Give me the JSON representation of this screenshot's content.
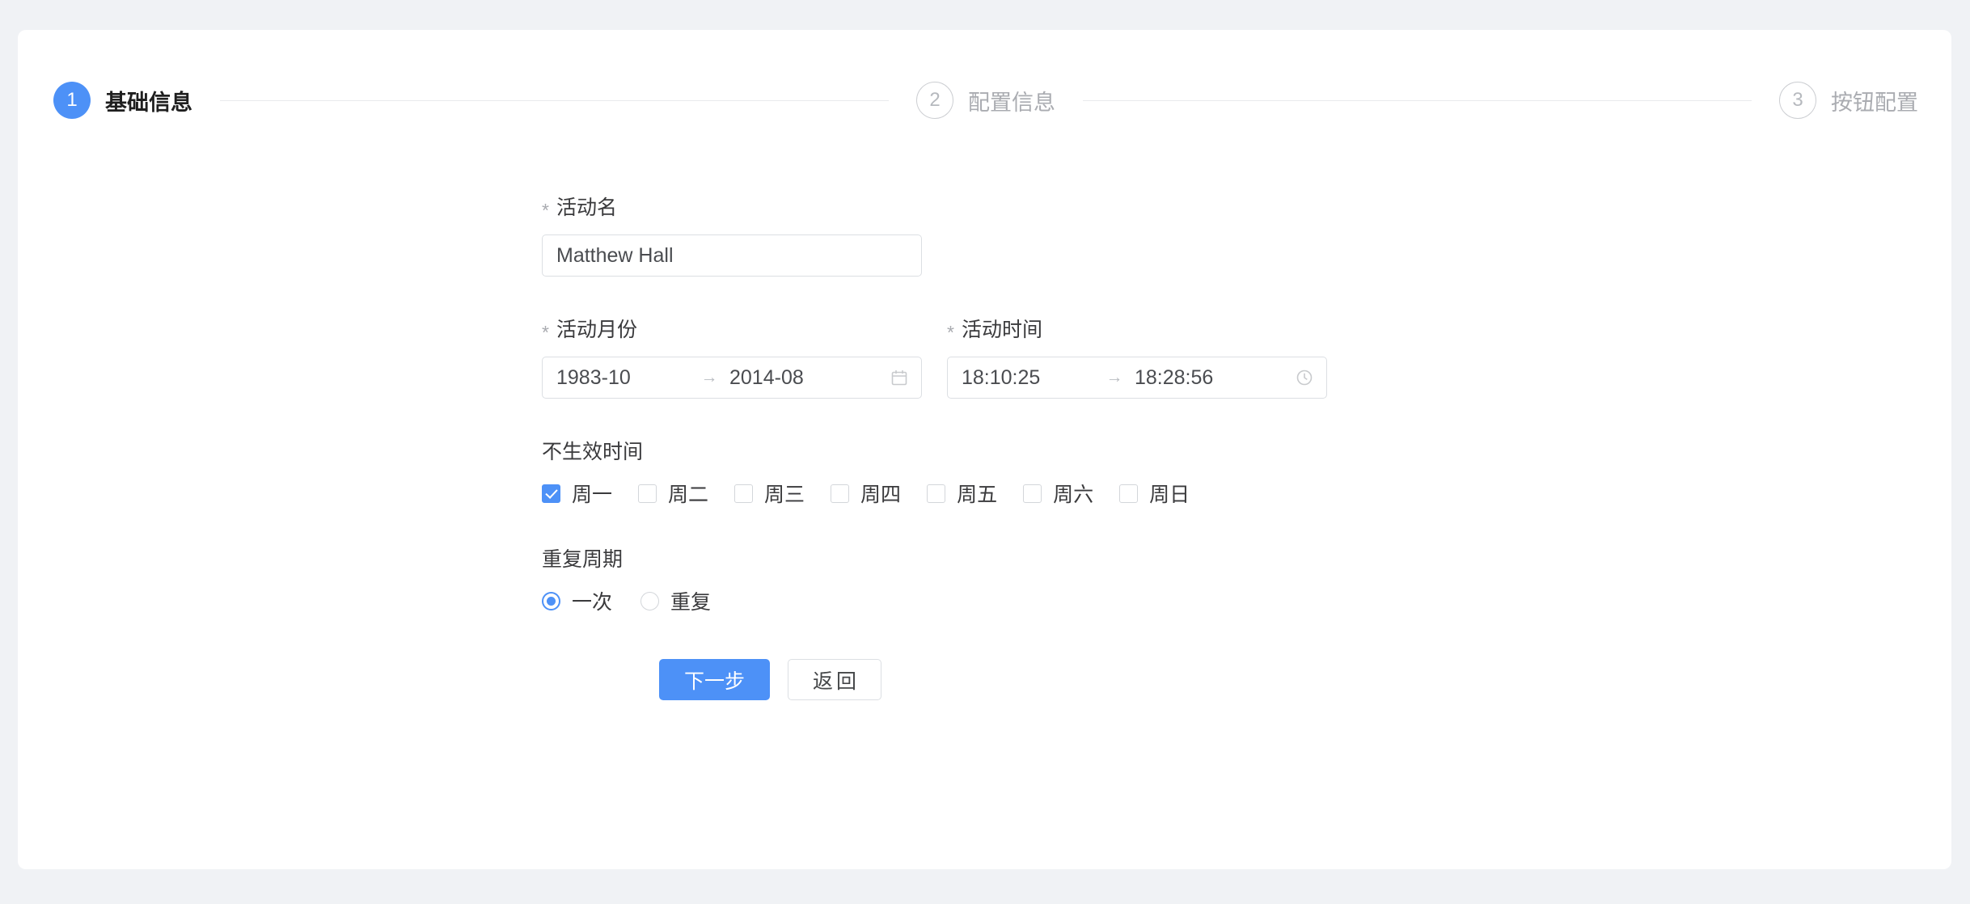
{
  "steps": [
    {
      "number": "1",
      "label": "基础信息",
      "state": "active"
    },
    {
      "number": "2",
      "label": "配置信息",
      "state": "inactive"
    },
    {
      "number": "3",
      "label": "按钮配置",
      "state": "inactive"
    }
  ],
  "form": {
    "activity_name": {
      "label": "活动名",
      "required_mark": "*",
      "value": "Matthew Hall",
      "placeholder": "活动名"
    },
    "activity_month": {
      "label": "活动月份",
      "required_mark": "*",
      "start": "1983-10",
      "end": "2014-08",
      "separator": "→",
      "icon": "calendar-icon"
    },
    "activity_time": {
      "label": "活动时间",
      "required_mark": "*",
      "start": "18:10:25",
      "end": "18:28:56",
      "separator": "→",
      "icon": "clock-icon"
    },
    "inactive_time": {
      "label": "不生效时间",
      "options": [
        {
          "label": "周一",
          "checked": true
        },
        {
          "label": "周二",
          "checked": false
        },
        {
          "label": "周三",
          "checked": false
        },
        {
          "label": "周四",
          "checked": false
        },
        {
          "label": "周五",
          "checked": false
        },
        {
          "label": "周六",
          "checked": false
        },
        {
          "label": "周日",
          "checked": false
        }
      ]
    },
    "repeat_cycle": {
      "label": "重复周期",
      "options": [
        {
          "label": "一次",
          "selected": true
        },
        {
          "label": "重复",
          "selected": false
        }
      ]
    }
  },
  "actions": {
    "next_label": "下一步",
    "back_label": "返回"
  },
  "colors": {
    "primary": "#4d91f7",
    "page_background": "#f0f2f5",
    "card_background": "#ffffff",
    "border": "#dcdfe3",
    "text": "#3a3a3c",
    "muted_text": "#aaacb1"
  }
}
